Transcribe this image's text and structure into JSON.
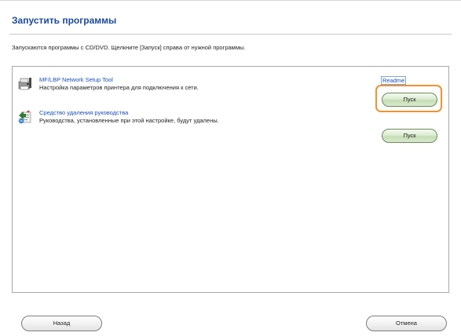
{
  "page": {
    "title": "Запустить программы",
    "description": "Запускаются программы с CD/DVD. Щелкните [Запуск] справа от нужной программы."
  },
  "programs": [
    {
      "name": "MF/LBP Network Setup Tool",
      "description": "Настройка параметров принтера для подключения к сети.",
      "icon": "printer-network-icon",
      "readme": "Readme",
      "launch_label": "Пуск"
    },
    {
      "name": "Средство удаления руководства",
      "description": "Руководства, установленные при этой настройке, будут удалены.",
      "icon": "uninstall-manual-icon",
      "launch_label": "Пуск"
    }
  ],
  "footer": {
    "back_label": "Назад",
    "cancel_label": "Отмена"
  },
  "colors": {
    "title": "#1b4a9b",
    "link": "#1b4fb8",
    "highlight": "#f0922f",
    "launch_button": "#d8eacb"
  }
}
